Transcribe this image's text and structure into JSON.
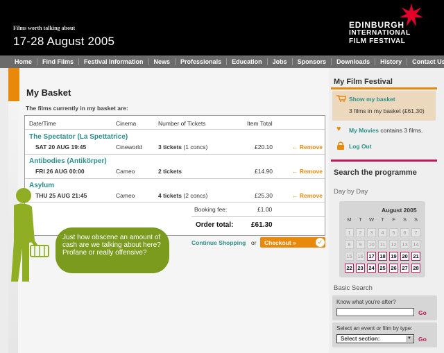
{
  "header": {
    "tagline": "Films worth talking about",
    "dates": "17-28 August 2005",
    "logo_line1": "EDINBURGH",
    "logo_line2": "INTERNATIONAL",
    "logo_line3": "FILM FESTIVAL",
    "star_color": "#e4002b"
  },
  "nav": [
    "Home",
    "Find Films",
    "Festival Information",
    "News",
    "Professionals",
    "Education",
    "Jobs",
    "Sponsors",
    "Downloads",
    "History",
    "Contact Us"
  ],
  "basket": {
    "title": "My Basket",
    "subtitle": "The films currently in my basket are:",
    "headers": {
      "date": "Date/Time",
      "cinema": "Cinema",
      "tickets": "Number of Tickets",
      "total": "Item Total"
    },
    "rows": [
      {
        "title": "The Spectator (La Spettatrice)",
        "date": "SAT 20 AUG 19:45",
        "cinema": "Cineworld",
        "tickets": "3 tickets",
        "concs": "(1 concs)",
        "price": "£20.10",
        "remove": "← Remove"
      },
      {
        "title": "Antibodies (Antikörper)",
        "date": "FRI 26 AUG 00:00",
        "cinema": "Cameo",
        "tickets": "2 tickets",
        "concs": "",
        "price": "£14.90",
        "remove": "← Remove"
      },
      {
        "title": "Asylum",
        "date": "THU 25 AUG 21:45",
        "cinema": "Cameo",
        "tickets": "4 tickets",
        "concs": "(2 concs)",
        "price": "£25.30",
        "remove": "← Remove"
      }
    ],
    "booking_fee_label": "Booking fee:",
    "booking_fee": "£1.00",
    "order_total_label": "Order total:",
    "order_total": "£61.30",
    "continue": "Continue Shopping",
    "or": "or",
    "checkout": "Checkout »"
  },
  "bubble": {
    "text": "Just how obscene an amount of cash are we talking about here? Profane or really offensive?",
    "color": "#7b9b1e"
  },
  "sidebar": {
    "heading": "My Film Festival",
    "show_basket": "Show my basket",
    "basket_count": "3 films in my basket (£61.30)",
    "my_movies": "My Movies",
    "my_movies_suffix": " contains 3 films.",
    "logout": "Log Out",
    "search_heading": "Search the programme",
    "day_by_day": "Day by Day",
    "calendar": {
      "month": "August 2005",
      "dow": [
        "M",
        "T",
        "W",
        "T",
        "F",
        "S",
        "S"
      ],
      "weeks": [
        [
          "1",
          "2",
          "3",
          "4",
          "5",
          "6",
          "7"
        ],
        [
          "8",
          "9",
          "10",
          "11",
          "12",
          "13",
          "14"
        ],
        [
          "15",
          "16",
          "17",
          "18",
          "19",
          "20",
          "21"
        ],
        [
          "22",
          "23",
          "24",
          "25",
          "26",
          "27",
          "28"
        ]
      ],
      "festival_days": [
        "17",
        "18",
        "19",
        "20",
        "21",
        "22",
        "23",
        "24",
        "25",
        "26",
        "27",
        "28"
      ]
    },
    "basic_search": "Basic Search",
    "know_label": "Know what you're after?",
    "go": "Go",
    "select_label": "Select an event or film by type:",
    "select_value": "Select section:"
  },
  "colors": {
    "accent_orange": "#e8890c",
    "link_teal": "#2a8f8a",
    "festival_pink": "#c2185b"
  }
}
